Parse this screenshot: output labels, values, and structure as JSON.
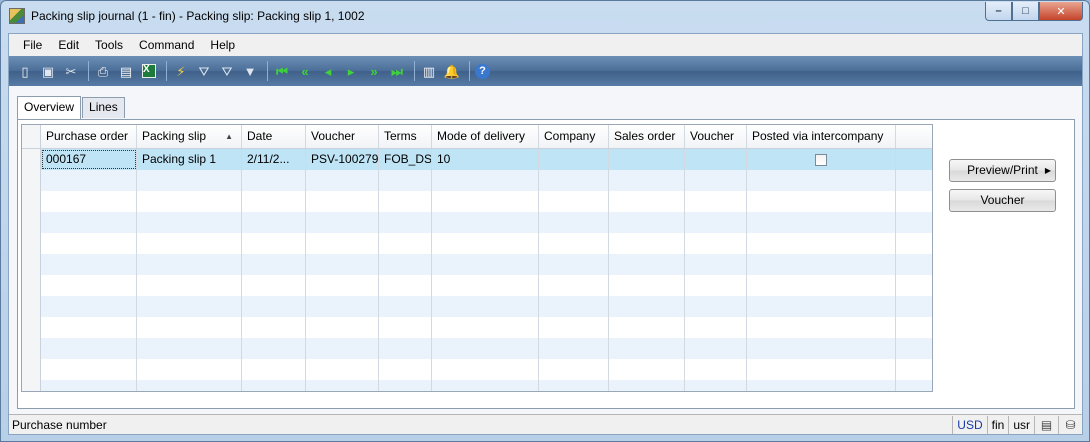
{
  "window": {
    "title": "Packing slip journal (1 - fin) - Packing slip: Packing slip 1, 1002",
    "minimize_label": "–",
    "maximize_label": "□",
    "close_label": "✕"
  },
  "menu": [
    "File",
    "Edit",
    "Tools",
    "Command",
    "Help"
  ],
  "toolbar": {
    "icons": [
      "new-document-icon",
      "save-icon",
      "delete-icon",
      "print-icon",
      "print-preview-icon",
      "export-to-excel-icon",
      "filter-by-selection-icon",
      "filter-by-grid-icon",
      "advanced-filter-icon",
      "filter-icon",
      "first-record-icon",
      "previous-page-icon",
      "previous-record-icon",
      "next-record-icon",
      "next-page-icon",
      "last-record-icon",
      "document-handling-icon",
      "alerts-icon",
      "help-icon"
    ]
  },
  "tabs": [
    {
      "label": "Overview",
      "active": true
    },
    {
      "label": "Lines",
      "active": false
    }
  ],
  "grid": {
    "columns": [
      "Purchase order",
      "Packing slip",
      "Date",
      "Voucher",
      "Terms",
      "Mode of delivery",
      "Company",
      "Sales order",
      "Voucher",
      "Posted via intercompany"
    ],
    "sorted_column": "Packing slip",
    "rows": [
      {
        "purchase_order": "000167",
        "packing_slip": "Packing slip 1",
        "date": "2/11/2...",
        "voucher": "PSV-100279",
        "terms": "FOB_DS",
        "mode_of_delivery": "10",
        "company": "",
        "sales_order": "",
        "voucher2": "",
        "posted_via_intercompany": false
      }
    ],
    "empty_rows": 11
  },
  "side_buttons": {
    "preview_print": "Preview/Print",
    "voucher": "Voucher"
  },
  "status": {
    "text": "Purchase number",
    "currency": "USD",
    "company": "fin",
    "layer": "usr"
  },
  "colors": {
    "selected_row": "#bfe4f5",
    "alt_row": "#eaf3fc",
    "toolbar": "#4b6e98"
  }
}
